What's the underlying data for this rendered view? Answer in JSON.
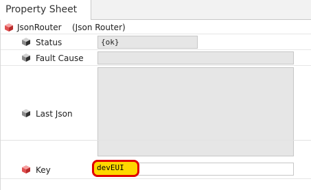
{
  "tab": {
    "label": "Property Sheet"
  },
  "root": {
    "name": "JsonRouter",
    "type": "(Json Router)"
  },
  "properties": [
    {
      "label": "Status",
      "value": "{ok}"
    },
    {
      "label": "Fault Cause",
      "value": ""
    },
    {
      "label": "Last Json",
      "value": ""
    },
    {
      "label": "Key",
      "value": "devEUI"
    }
  ],
  "colors": {
    "highlight_fill": "#ffd700",
    "highlight_border": "#e00000",
    "root_icon": "#d94b4b"
  },
  "icons": {
    "root": "component-cube-icon-red",
    "property": "property-cube-icon",
    "key": "property-cube-icon-red"
  }
}
